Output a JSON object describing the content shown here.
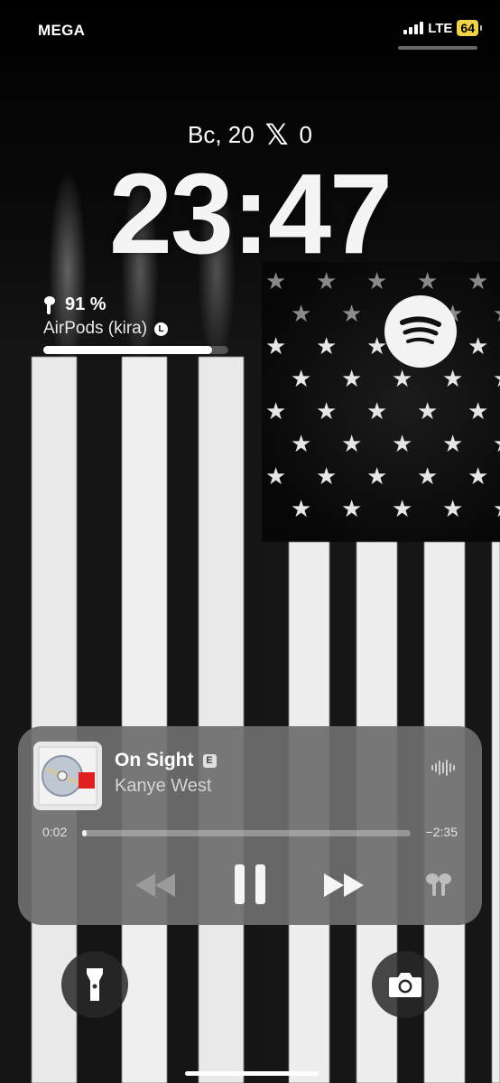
{
  "status_bar": {
    "carrier": "MEGA",
    "network": "LTE",
    "battery": "64"
  },
  "lock_screen": {
    "date": "Вс, 20",
    "x_count": "0",
    "time": "23:47"
  },
  "airpods_widget": {
    "battery_percent": "91 %",
    "battery_level": 0.91,
    "device_name": "AirPods (kira)",
    "badge": "L"
  },
  "spotify_widget": {
    "icon": "spotify-icon"
  },
  "now_playing": {
    "title": "On Sight",
    "explicit": "E",
    "artist": "Kanye West",
    "elapsed": "0:02",
    "remaining": "−2:35",
    "progress": 0.013
  },
  "icons": {
    "flashlight": "flashlight-icon",
    "camera": "camera-icon",
    "rewind": "rewind-icon",
    "pause": "pause-icon",
    "fast_forward": "fast-forward-icon",
    "airpods_output": "airpods-icon",
    "waveform": "waveform-icon"
  },
  "colors": {
    "battery_badge": "#f0d34b",
    "player_bg": "#6e6e6e"
  }
}
